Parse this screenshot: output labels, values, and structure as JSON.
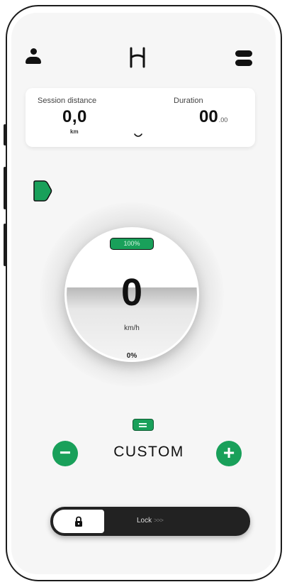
{
  "header": {
    "profile_icon": "user-icon",
    "logo_icon": "bike-logo-icon",
    "menu_icon": "menu-icon"
  },
  "stats": {
    "distance_label": "Session distance",
    "distance_value": "0,0",
    "distance_unit": "km",
    "duration_label": "Duration",
    "duration_value": "00",
    "duration_decimal": ".00"
  },
  "gauge": {
    "battery_label": "100%",
    "speed": "0",
    "speed_unit": "km/h",
    "power_label": "0%"
  },
  "mode": {
    "name": "CUSTOM",
    "minus_label": "−",
    "plus_label": "+"
  },
  "lock": {
    "label": "Lock",
    "arrows": ">>>"
  },
  "colors": {
    "accent": "#19a05a",
    "dark": "#222222",
    "background": "#f6f6f6"
  }
}
